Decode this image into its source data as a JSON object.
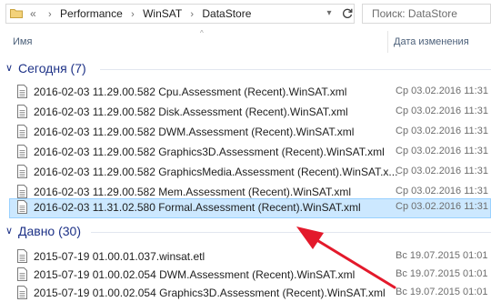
{
  "address_bar": {
    "overflow": "«",
    "crumbs": [
      "Performance",
      "WinSAT",
      "DataStore"
    ],
    "search_placeholder": "Поиск: DataStore"
  },
  "columns": {
    "name": "Имя",
    "date_modified": "Дата изменения"
  },
  "groups": [
    {
      "title": "Сегодня (7)",
      "files": [
        {
          "name": "2016-02-03 11.29.00.582 Cpu.Assessment (Recent).WinSAT.xml",
          "date": "Ср 03.02.2016 11:31"
        },
        {
          "name": "2016-02-03 11.29.00.582 Disk.Assessment (Recent).WinSAT.xml",
          "date": "Ср 03.02.2016 11:31"
        },
        {
          "name": "2016-02-03 11.29.00.582 DWM.Assessment (Recent).WinSAT.xml",
          "date": "Ср 03.02.2016 11:31"
        },
        {
          "name": "2016-02-03 11.29.00.582 Graphics3D.Assessment (Recent).WinSAT.xml",
          "date": "Ср 03.02.2016 11:31"
        },
        {
          "name": "2016-02-03 11.29.00.582 GraphicsMedia.Assessment (Recent).WinSAT.x...",
          "date": "Ср 03.02.2016 11:31"
        },
        {
          "name": "2016-02-03 11.29.00.582 Mem.Assessment (Recent).WinSAT.xml",
          "date": "Ср 03.02.2016 11:31"
        },
        {
          "name": "2016-02-03 11.31.02.580 Formal.Assessment (Recent).WinSAT.xml",
          "date": "Ср 03.02.2016 11:31",
          "selected": true
        }
      ]
    },
    {
      "title": "Давно (30)",
      "files": [
        {
          "name": "2015-07-19 01.00.01.037.winsat.etl",
          "date": "Вс 19.07.2015 01:01"
        },
        {
          "name": "2015-07-19 01.00.02.054 DWM.Assessment (Recent).WinSAT.xml",
          "date": "Вс 19.07.2015 01:01"
        },
        {
          "name": "2015-07-19 01.00.02.054 Graphics3D.Assessment (Recent).WinSAT.xml",
          "date": "Вс 19.07.2015 01:01"
        }
      ]
    }
  ],
  "colors": {
    "group_title": "#1e3287",
    "selection_bg": "#cce8ff",
    "selection_border": "#99d1ff",
    "annotation_arrow": "#e3192b"
  }
}
